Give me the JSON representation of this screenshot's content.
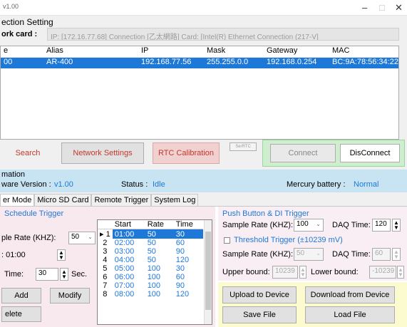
{
  "window": {
    "title": "v1.00",
    "minimize": "–",
    "maximize": "□",
    "close": "✕"
  },
  "connection": {
    "section_title": "ection Setting",
    "network_card_label": "ork card :",
    "network_card_value": "IP: [172.16.77.68] Connection [乙太網路] Card: [Intel(R) Ethernet Connection (217-V]"
  },
  "device_list": {
    "columns": [
      "e",
      "Alias",
      "IP",
      "Mask",
      "Gateway",
      "MAC"
    ],
    "rows": [
      {
        "name": "00",
        "alias": "AR-400",
        "ip": "192.168.77.56",
        "mask": "255.255.0.0",
        "gateway": "192.168.0.254",
        "mac": "BC:9A:78:56:34:22"
      }
    ]
  },
  "buttons": {
    "search": "Search",
    "network_settings": "Network Settings",
    "rtc_calibration": "RTC Calibration",
    "small_tag": "SerRTC",
    "connect": "Connect",
    "disconnect": "DisConnect"
  },
  "info": {
    "section_title": "mation",
    "firmware_label": "ware Version :",
    "firmware_value": "v1.00",
    "status_label": "Status :",
    "status_value": "Idle",
    "battery_label": "Mercury battery :",
    "battery_value": "Normal"
  },
  "tabs": [
    "er Mode",
    "Micro SD Card",
    "Remote Trigger",
    "System Log"
  ],
  "schedule": {
    "title": "Schedule Trigger",
    "sample_rate_label": "ple Rate (KHZ):",
    "sample_rate_value": "50",
    "start_label": ": 01:00",
    "daq_label": "Time:",
    "daq_value": "30",
    "sec_label": "Sec.",
    "add": "Add",
    "modify": "Modify",
    "delete": "elete",
    "table_headers": [
      "",
      "Start",
      "Rate",
      "Time"
    ],
    "rows": [
      {
        "n": "1",
        "start": "01:00",
        "rate": "50",
        "time": "30"
      },
      {
        "n": "2",
        "start": "02:00",
        "rate": "50",
        "time": "60"
      },
      {
        "n": "3",
        "start": "03:00",
        "rate": "50",
        "time": "90"
      },
      {
        "n": "4",
        "start": "04:00",
        "rate": "50",
        "time": "120"
      },
      {
        "n": "5",
        "start": "05:00",
        "rate": "100",
        "time": "30"
      },
      {
        "n": "6",
        "start": "06:00",
        "rate": "100",
        "time": "60"
      },
      {
        "n": "7",
        "start": "07:00",
        "rate": "100",
        "time": "90"
      },
      {
        "n": "8",
        "start": "08:00",
        "rate": "100",
        "time": "120"
      }
    ],
    "selected_marker": "▸"
  },
  "push_button": {
    "title": "Push Button & DI Trigger",
    "sample_rate_label": "Sample Rate (KHZ):",
    "sample_rate_value": "100",
    "daq_label": "DAQ Time:",
    "daq_value": "120"
  },
  "threshold": {
    "title": "Threshold Trigger (±10239 mV)",
    "sample_rate_label": "Sample Rate (KHZ):",
    "sample_rate_value": "50",
    "daq_label": "DAQ Time:",
    "daq_value": "60",
    "upper_label": "Upper bound:",
    "upper_value": "10239",
    "lower_label": "Lower bound:",
    "lower_value": "-10239"
  },
  "file_buttons": {
    "upload": "Upload to Device",
    "download": "Download from Device",
    "save": "Save File",
    "load": "Load File"
  },
  "colors": {
    "accent_blue": "#1e78d7",
    "red_text": "#c0392b",
    "info_panel": "#c8e4f2",
    "connect_panel": "#cfeecf",
    "yellow_panel": "#fbfbcf"
  }
}
